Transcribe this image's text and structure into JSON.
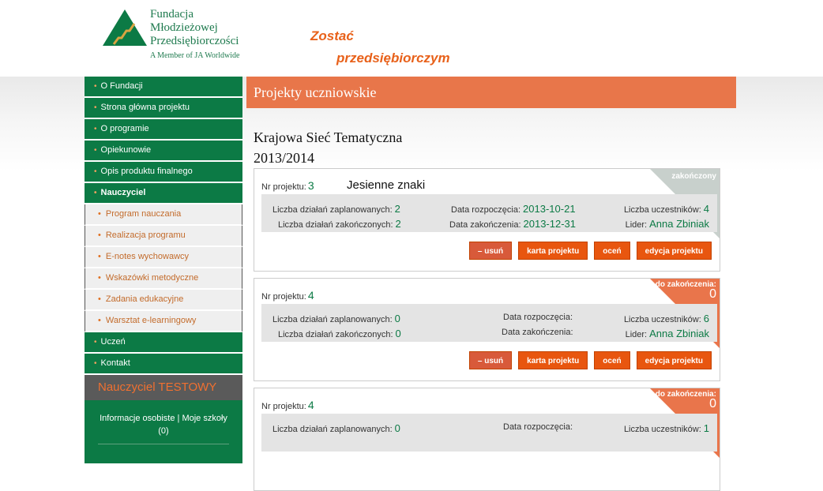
{
  "org": {
    "line1": "Fundacja",
    "line2": "Młodzieżowej",
    "line3": "Przedsiębiorczości",
    "member": "A Member of JA Worldwide"
  },
  "slogan": {
    "line1": "Zostać",
    "line2": "przedsiębiorczym"
  },
  "nav": [
    {
      "label": "O Fundacji"
    },
    {
      "label": "Strona główna projektu"
    },
    {
      "label": "O programie"
    },
    {
      "label": "Opiekunowie"
    },
    {
      "label": "Opis produktu finalnego"
    },
    {
      "label": "Nauczyciel"
    }
  ],
  "subnav": [
    {
      "label": "Program nauczania"
    },
    {
      "label": "Realizacja programu"
    },
    {
      "label": "E-notes wychowawcy"
    },
    {
      "label": "Wskazówki metodyczne"
    },
    {
      "label": "Zadania edukacyjne"
    },
    {
      "label": "Warsztat e-learningowy"
    }
  ],
  "nav_bottom": [
    {
      "label": "Uczeń"
    },
    {
      "label": "Kontakt"
    }
  ],
  "user": {
    "name": "Nauczyciel TESTOWY",
    "links": "Informacje osobiste | Moje szkoły",
    "count": "(0)"
  },
  "page": {
    "title": "Projekty uczniowskie",
    "section": "Krajowa Sieć Tematyczna",
    "year": "2013/2014"
  },
  "labels": {
    "nr": "Nr projektu:",
    "planned": "Liczba działań zaplanowanych:",
    "finished": "Liczba działań zakończonych:",
    "start": "Data rozpoczęcia:",
    "end": "Data zakończenia:",
    "participants": "Liczba uczestników:",
    "leader": "Lider:",
    "btn_delete": "– usuń",
    "btn_card": "karta projektu",
    "btn_rate": "oceń",
    "btn_edit": "edycja projektu"
  },
  "projects": [
    {
      "nr": "3",
      "name": "Jesienne znaki",
      "planned": "2",
      "finished": "2",
      "start": "2013-10-21",
      "end": "2013-12-31",
      "participants": "4",
      "leader": "Anna Zbiniak",
      "status": "zakończony",
      "remaining": ""
    },
    {
      "nr": "4",
      "name": "",
      "planned": "0",
      "finished": "0",
      "start": "",
      "end": "",
      "participants": "6",
      "leader": "Anna Zbiniak",
      "status": "do zakończenia:",
      "remaining": "0"
    },
    {
      "nr": "4",
      "name": "",
      "planned": "0",
      "finished": "",
      "start": "",
      "end": "",
      "participants": "1",
      "leader": "",
      "status": "do zakończenia:",
      "remaining": "0"
    }
  ],
  "colors": {
    "green": "#0c7a45",
    "orange": "#e8560f",
    "header_orange": "#e8764a"
  }
}
